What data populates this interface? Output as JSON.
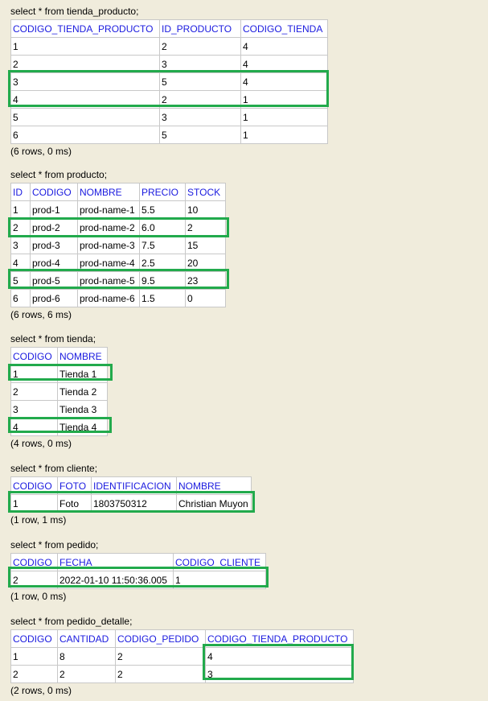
{
  "sections": [
    {
      "query": "select * from tienda_producto;",
      "columns": [
        "CODIGO_TIENDA_PRODUCTO",
        "ID_PRODUCTO",
        "CODIGO_TIENDA"
      ],
      "rows": [
        [
          "1",
          "2",
          "4"
        ],
        [
          "2",
          "3",
          "4"
        ],
        [
          "3",
          "5",
          "4"
        ],
        [
          "4",
          "2",
          "1"
        ],
        [
          "5",
          "3",
          "1"
        ],
        [
          "6",
          "5",
          "1"
        ]
      ],
      "summary": "(6 rows, 0 ms)"
    },
    {
      "query": "select * from producto;",
      "columns": [
        "ID",
        "CODIGO",
        "NOMBRE",
        "PRECIO",
        "STOCK"
      ],
      "rows": [
        [
          "1",
          "prod-1",
          "prod-name-1",
          "5.5",
          "10"
        ],
        [
          "2",
          "prod-2",
          "prod-name-2",
          "6.0",
          "2"
        ],
        [
          "3",
          "prod-3",
          "prod-name-3",
          "7.5",
          "15"
        ],
        [
          "4",
          "prod-4",
          "prod-name-4",
          "2.5",
          "20"
        ],
        [
          "5",
          "prod-5",
          "prod-name-5",
          "9.5",
          "23"
        ],
        [
          "6",
          "prod-6",
          "prod-name-6",
          "1.5",
          "0"
        ]
      ],
      "summary": "(6 rows, 6 ms)"
    },
    {
      "query": "select * from tienda;",
      "columns": [
        "CODIGO",
        "NOMBRE"
      ],
      "rows": [
        [
          "1",
          "Tienda 1"
        ],
        [
          "2",
          "Tienda 2"
        ],
        [
          "3",
          "Tienda 3"
        ],
        [
          "4",
          "Tienda 4"
        ]
      ],
      "summary": "(4 rows, 0 ms)"
    },
    {
      "query": "select * from cliente;",
      "columns": [
        "CODIGO",
        "FOTO",
        "IDENTIFICACION",
        "NOMBRE"
      ],
      "rows": [
        [
          "1",
          "Foto",
          "1803750312",
          "Christian Muyon"
        ]
      ],
      "summary": "(1 row, 1 ms)"
    },
    {
      "query": "select * from pedido;",
      "columns": [
        "CODIGO",
        "FECHA",
        "CODIGO_CLIENTE"
      ],
      "rows": [
        [
          "2",
          "2022-01-10 11:50:36.005",
          "1"
        ]
      ],
      "summary": "(1 row, 0 ms)"
    },
    {
      "query": "select * from pedido_detalle;",
      "columns": [
        "CODIGO",
        "CANTIDAD",
        "CODIGO_PEDIDO",
        "CODIGO_TIENDA_PRODUCTO"
      ],
      "rows": [
        [
          "1",
          "8",
          "2",
          "4"
        ],
        [
          "2",
          "2",
          "2",
          "3"
        ]
      ],
      "summary": "(2 rows, 0 ms)"
    }
  ],
  "colors": {
    "background": "#f0ecdc",
    "header_text": "#1a1adf",
    "highlight_border": "#22aa4c",
    "grid_border": "#c8c8c8"
  }
}
